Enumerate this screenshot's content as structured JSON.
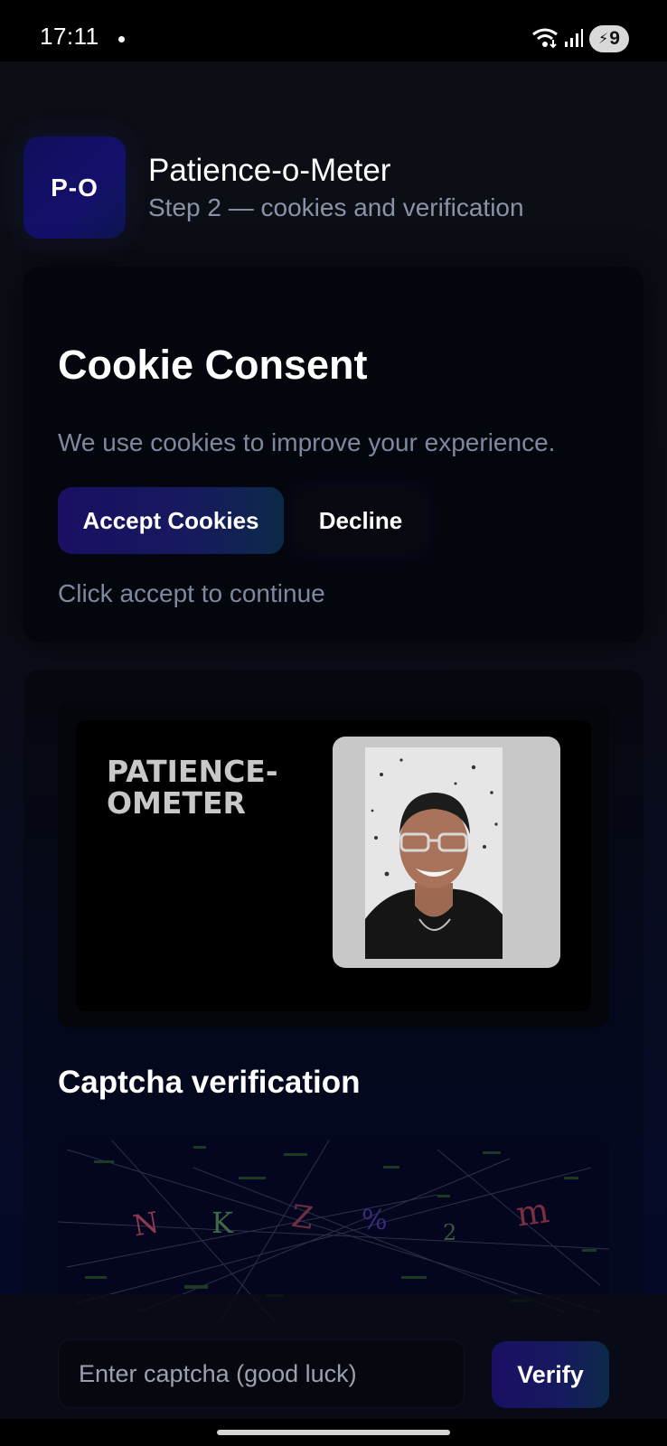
{
  "status_bar": {
    "time": "17:11",
    "battery": "9"
  },
  "app": {
    "logo_text": "P-O",
    "title": "Patience-o-Meter",
    "subtitle": "Step 2 — cookies and verification"
  },
  "cookie_card": {
    "title": "Cookie Consent",
    "text": "We use cookies to improve your experience.",
    "accept_label": "Accept Cookies",
    "decline_label": "Decline",
    "hint": "Click accept to continue"
  },
  "banner": {
    "text": "PATIENCE-OMETER"
  },
  "captcha": {
    "title": "Captcha verification",
    "characters": [
      "N",
      "K",
      "Z",
      "%",
      "2",
      "m"
    ],
    "input_placeholder": "Enter captcha (good luck)",
    "verify_label": "Verify"
  },
  "colors": {
    "accent_gradient_start": "#1a0f63",
    "accent_gradient_end": "#0c2a48",
    "muted_text": "#7f889c"
  }
}
